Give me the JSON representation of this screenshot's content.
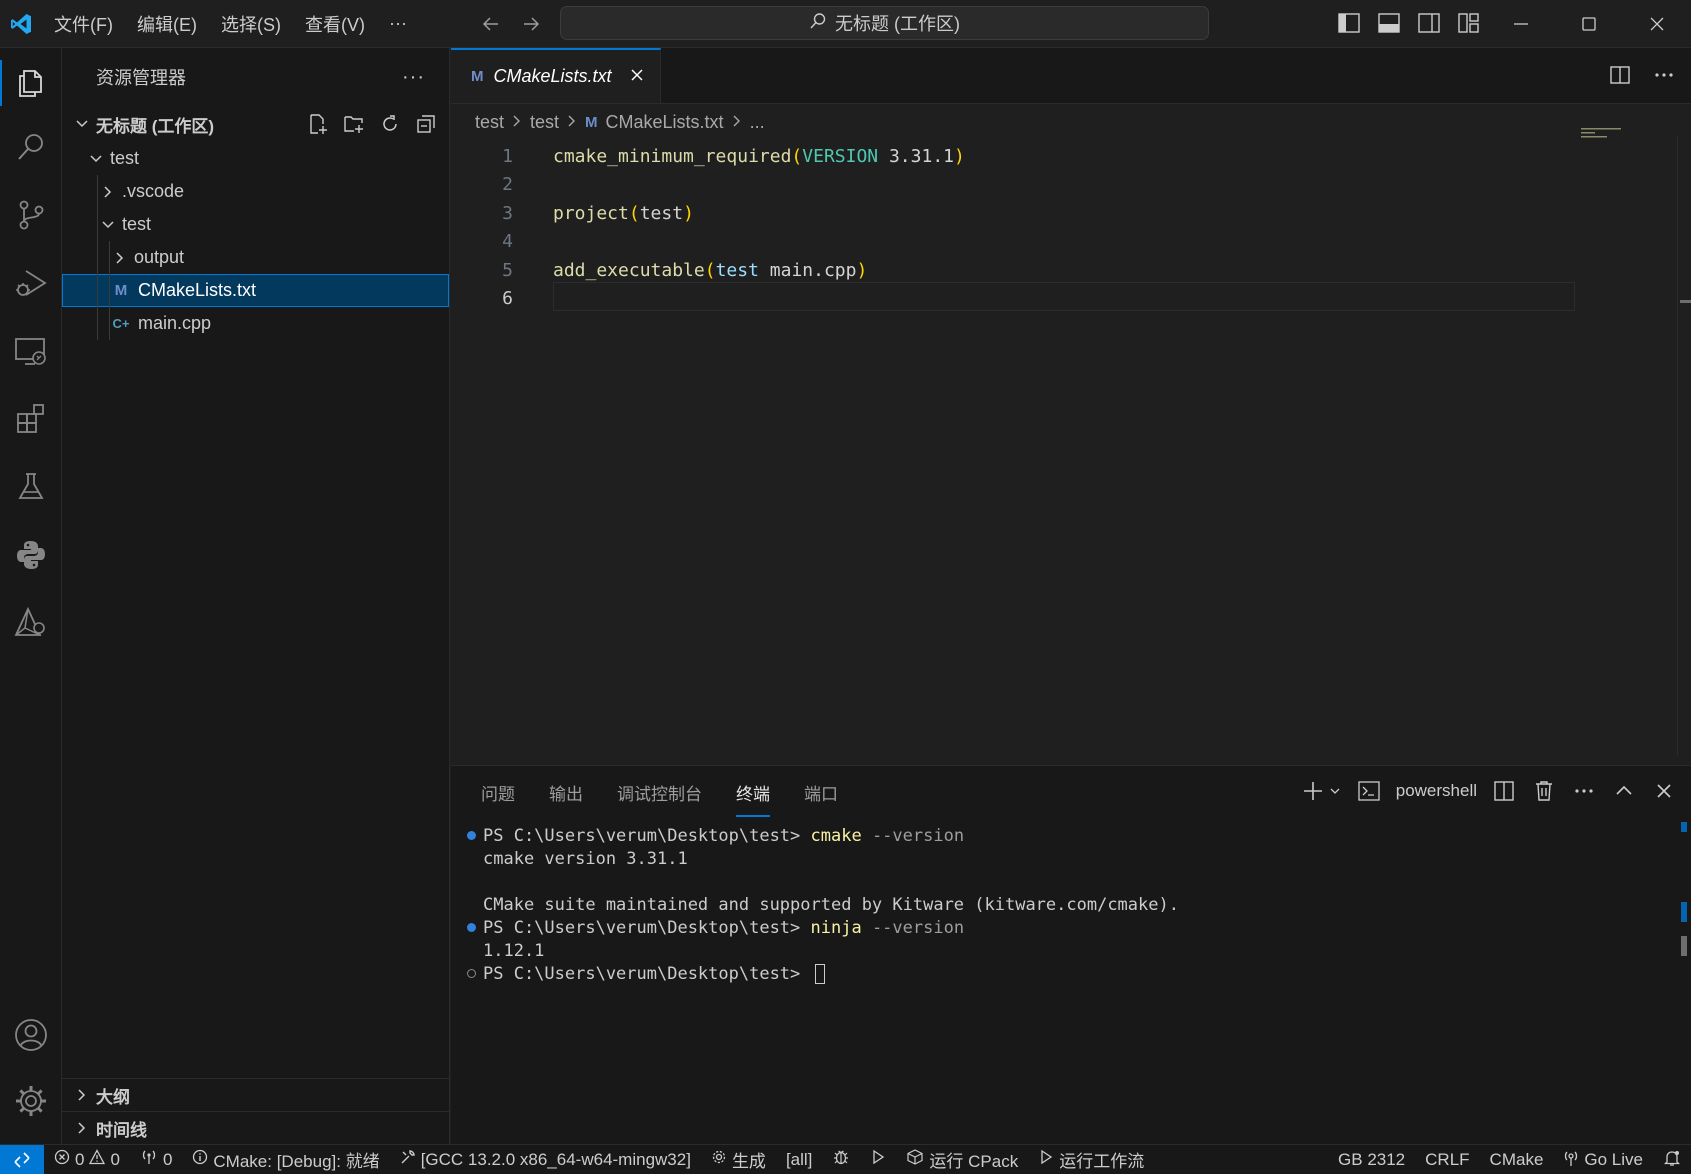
{
  "titlebar": {
    "menu": [
      "文件(F)",
      "编辑(E)",
      "选择(S)",
      "查看(V)",
      "···"
    ],
    "search_text": "无标题 (工作区)"
  },
  "sidebar": {
    "title": "资源管理器",
    "more": "···",
    "workspace": "无标题 (工作区)",
    "tree": [
      {
        "label": "test",
        "type": "folder-open"
      },
      {
        "label": ".vscode",
        "type": "folder-closed"
      },
      {
        "label": "test",
        "type": "folder-open"
      },
      {
        "label": "output",
        "type": "folder-closed"
      },
      {
        "label": "CMakeLists.txt",
        "type": "file",
        "icon_text": "M",
        "selected": true
      },
      {
        "label": "main.cpp",
        "type": "file",
        "icon_text": "C+"
      }
    ],
    "outline": "大纲",
    "timeline": "时间线"
  },
  "editor": {
    "tab_label": "CMakeLists.txt",
    "tab_icon_text": "M",
    "breadcrumb": [
      "test",
      "test",
      "CMakeLists.txt",
      "..."
    ],
    "line_numbers": [
      "1",
      "2",
      "3",
      "4",
      "5",
      "6"
    ],
    "lines": {
      "l1_fn": "cmake_minimum_required",
      "l1_kw": "VERSION",
      "l1_val": "3.31.1",
      "l3_fn": "project",
      "l3_arg": "test",
      "l5_fn": "add_executable",
      "l5_arg": "test",
      "l5_val": "main.cpp"
    }
  },
  "panel": {
    "tabs": [
      "问题",
      "输出",
      "调试控制台",
      "终端",
      "端口"
    ],
    "active_tab": "终端",
    "shell": "powershell",
    "terminal": {
      "prompt": "PS C:\\Users\\verum\\Desktop\\test> ",
      "cmd1": "cmake",
      "flag1": " --version",
      "out1": "cmake version 3.31.1",
      "out2": "CMake suite maintained and supported by Kitware (kitware.com/cmake).",
      "cmd2": "ninja",
      "flag2": " --version",
      "out3": "1.12.1"
    }
  },
  "statusbar": {
    "errors": "0",
    "warnings": "0",
    "ports": "0",
    "cmake_status": "CMake: [Debug]: 就绪",
    "kit": "[GCC 13.2.0 x86_64-w64-mingw32]",
    "build": "生成",
    "target": "[all]",
    "cpack": "运行 CPack",
    "workflow": "运行工作流",
    "encoding": "GB 2312",
    "eol": "CRLF",
    "language": "CMake",
    "golive": "Go Live"
  },
  "colors": {
    "accent": "#0078d4",
    "selection": "#04395e",
    "function": "#dcdcaa",
    "paren": "#ffd700",
    "keyword": "#4ec9b0",
    "argument": "#9cdcfe"
  }
}
